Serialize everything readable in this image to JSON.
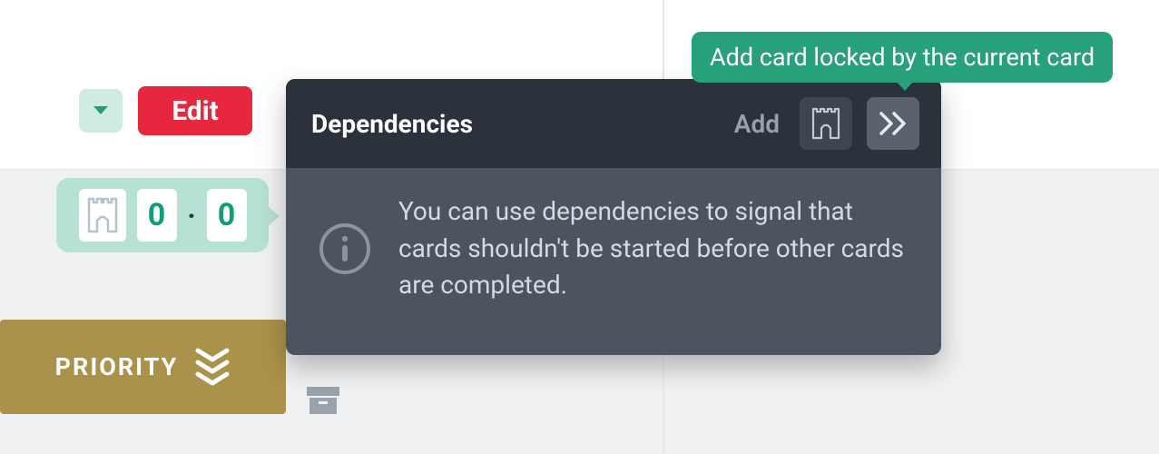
{
  "colors": {
    "accent_green": "#27a07c",
    "edit_red": "#e6273e",
    "priority_gold": "#ab924a",
    "popover_dark": "#2b323c",
    "popover_body": "#4c545f"
  },
  "toolbar": {
    "edit_label": "Edit"
  },
  "dependency_counter": {
    "left_count": "0",
    "right_count": "0"
  },
  "priority": {
    "label": "PRIORITY"
  },
  "popover": {
    "title": "Dependencies",
    "add_label": "Add",
    "info_text": "You can use dependencies to signal that cards shouldn't be started before other cards are completed."
  },
  "tooltip": {
    "text": "Add card locked by the current card"
  }
}
